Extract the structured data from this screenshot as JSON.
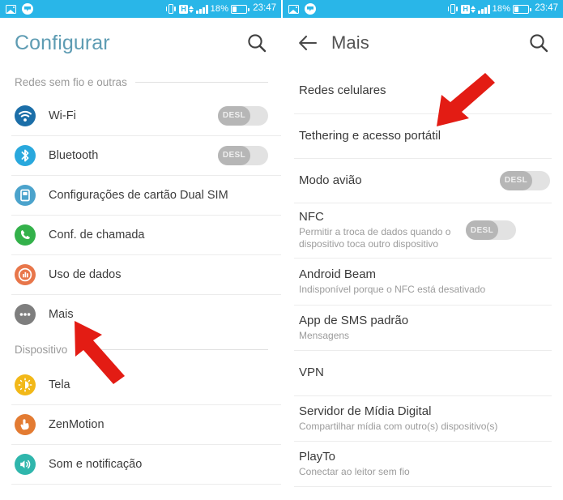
{
  "statusbar": {
    "icons_left": [
      "gallery-icon",
      "messenger-icon"
    ],
    "icons_right": [
      "vibrate-icon",
      "hspa-h-icon",
      "data-updown-icon",
      "signal-bars-icon"
    ],
    "battery_percent": "18%",
    "battery_icon": "battery-icon",
    "clock": "23:47",
    "background_color": "#29b6e8"
  },
  "left_screen": {
    "appbar": {
      "title": "Configurar",
      "title_color": "#5e9cb3",
      "search_icon": "search-icon"
    },
    "sections": [
      {
        "header": "Redes sem fio e outras",
        "rows": [
          {
            "title": "Wi-Fi",
            "icon": "wifi-icon",
            "icon_color": "#1b6ea8",
            "toggle": "DESL"
          },
          {
            "title": "Bluetooth",
            "icon": "bluetooth-icon",
            "icon_color": "#29a8dd",
            "toggle": "DESL"
          },
          {
            "title": "Configurações de cartão Dual SIM",
            "icon": "sim-card-icon",
            "icon_color": "#4ba3cc"
          },
          {
            "title": "Conf. de chamada",
            "icon": "phone-icon",
            "icon_color": "#33b14a"
          },
          {
            "title": "Uso de dados",
            "icon": "data-usage-icon",
            "icon_color": "#e8764a"
          },
          {
            "title": "Mais",
            "icon": "more-dots-icon",
            "icon_color": "#7e7e7e"
          }
        ]
      },
      {
        "header": "Dispositivo",
        "rows": [
          {
            "title": "Tela",
            "icon": "brightness-icon",
            "icon_color": "#f2b818"
          },
          {
            "title": "ZenMotion",
            "icon": "hand-tap-icon",
            "icon_color": "#e37b32"
          },
          {
            "title": "Som e notificação",
            "icon": "sound-icon",
            "icon_color": "#2fb6ac"
          }
        ]
      }
    ],
    "annotation_arrow": "red-arrow-pointing-up-left-at-mais"
  },
  "right_screen": {
    "appbar": {
      "back_icon": "back-arrow-icon",
      "title": "Mais",
      "title_color": "#535353",
      "search_icon": "search-icon"
    },
    "rows": [
      {
        "title": "Redes celulares"
      },
      {
        "title": "Tethering e acesso portátil"
      },
      {
        "title": "Modo avião",
        "toggle": "DESL"
      },
      {
        "title": "NFC",
        "subtitle": "Permitir a troca de dados quando o dispositivo toca outro dispositivo",
        "toggle": "DESL"
      },
      {
        "title": "Android Beam",
        "subtitle": "Indisponível porque o NFC está desativado",
        "disabled": true
      },
      {
        "title": "App de SMS padrão",
        "subtitle": "Mensagens"
      },
      {
        "title": "VPN"
      },
      {
        "title": "Servidor de Mídia Digital",
        "subtitle": "Compartilhar mídia com outro(s) dispositivo(s)"
      },
      {
        "title": "PlayTo",
        "subtitle": "Conectar ao leitor sem fio"
      }
    ],
    "annotation_arrow": "red-arrow-pointing-down-left-at-tethering"
  },
  "annotation_color": "#e31c14"
}
